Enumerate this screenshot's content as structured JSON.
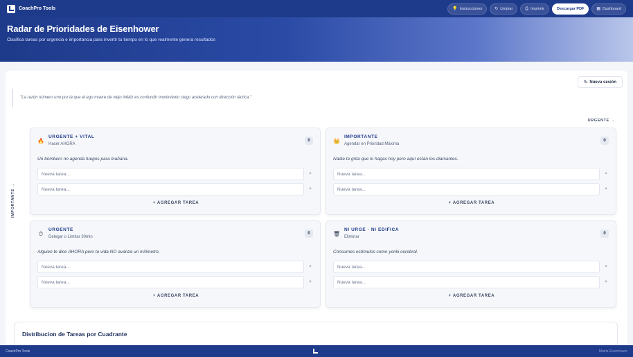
{
  "brand": {
    "name": "CoachPro Tools",
    "logo_icon": "logo-icon"
  },
  "nav": {
    "instructions": {
      "label": "Instrucciones",
      "icon": "bulb-icon"
    },
    "clear": {
      "label": "Limpiar",
      "icon": "refresh-icon"
    },
    "print": {
      "label": "Imprimir",
      "icon": "printer-icon"
    },
    "download": {
      "label": "Descargar PDF"
    },
    "dashboard": {
      "label": "Dashboard",
      "icon": "grid-icon"
    }
  },
  "hero": {
    "title": "Radar de Prioridades de Eisenhower",
    "subtitle": "Clasifica tareas por urgencia e importancia para invertir tu tiempo en lo que realmente genera resultados"
  },
  "session": {
    "new_label": "Nueva sesión",
    "icon": "refresh-icon"
  },
  "quote": "\"La razón número uno por la que el ego muere de viejo infeliz es confundir movimiento ciego acelerado con dirección táctica.\"",
  "axes": {
    "x_label": "URGENTE →",
    "y_label": "IMPORTANTE →"
  },
  "task_placeholder": "Nueva tarea...",
  "add_task_label": "+ AGREGAR TAREA",
  "delete_glyph": "×",
  "quadrants": [
    {
      "title": "URGENTE + VITAL",
      "subtitle": "Hacer AHORA",
      "count": "0",
      "icon": "fire-icon",
      "glyph": "🔥",
      "description": "Un bombero no agenda fuegos para mañana."
    },
    {
      "title": "IMPORTANTE",
      "subtitle": "Agendar en Prioridad Máxima",
      "count": "0",
      "icon": "crown-icon",
      "glyph": "👑",
      "description": "Nadie te grita que lo hagas hoy pero aquí están los diamantes."
    },
    {
      "title": "URGENTE",
      "subtitle": "Delegar o Limitar 30min",
      "count": "0",
      "icon": "timer-icon",
      "glyph": "⏱",
      "description": "Alguien te dice AHORA pero tu vida NO avanza un milímetro."
    },
    {
      "title": "NI URGE · NI EDIFICA",
      "subtitle": "Eliminar",
      "count": "0",
      "icon": "trash-icon",
      "glyph": "🗑",
      "description": "Consumes estímulos como yonki cerebral."
    }
  ],
  "distribution": {
    "title": "Distribucion de Tareas por Cuadrante"
  },
  "footer": {
    "left": "CoachPro Tools",
    "right": "Matriz Eisenhower"
  }
}
